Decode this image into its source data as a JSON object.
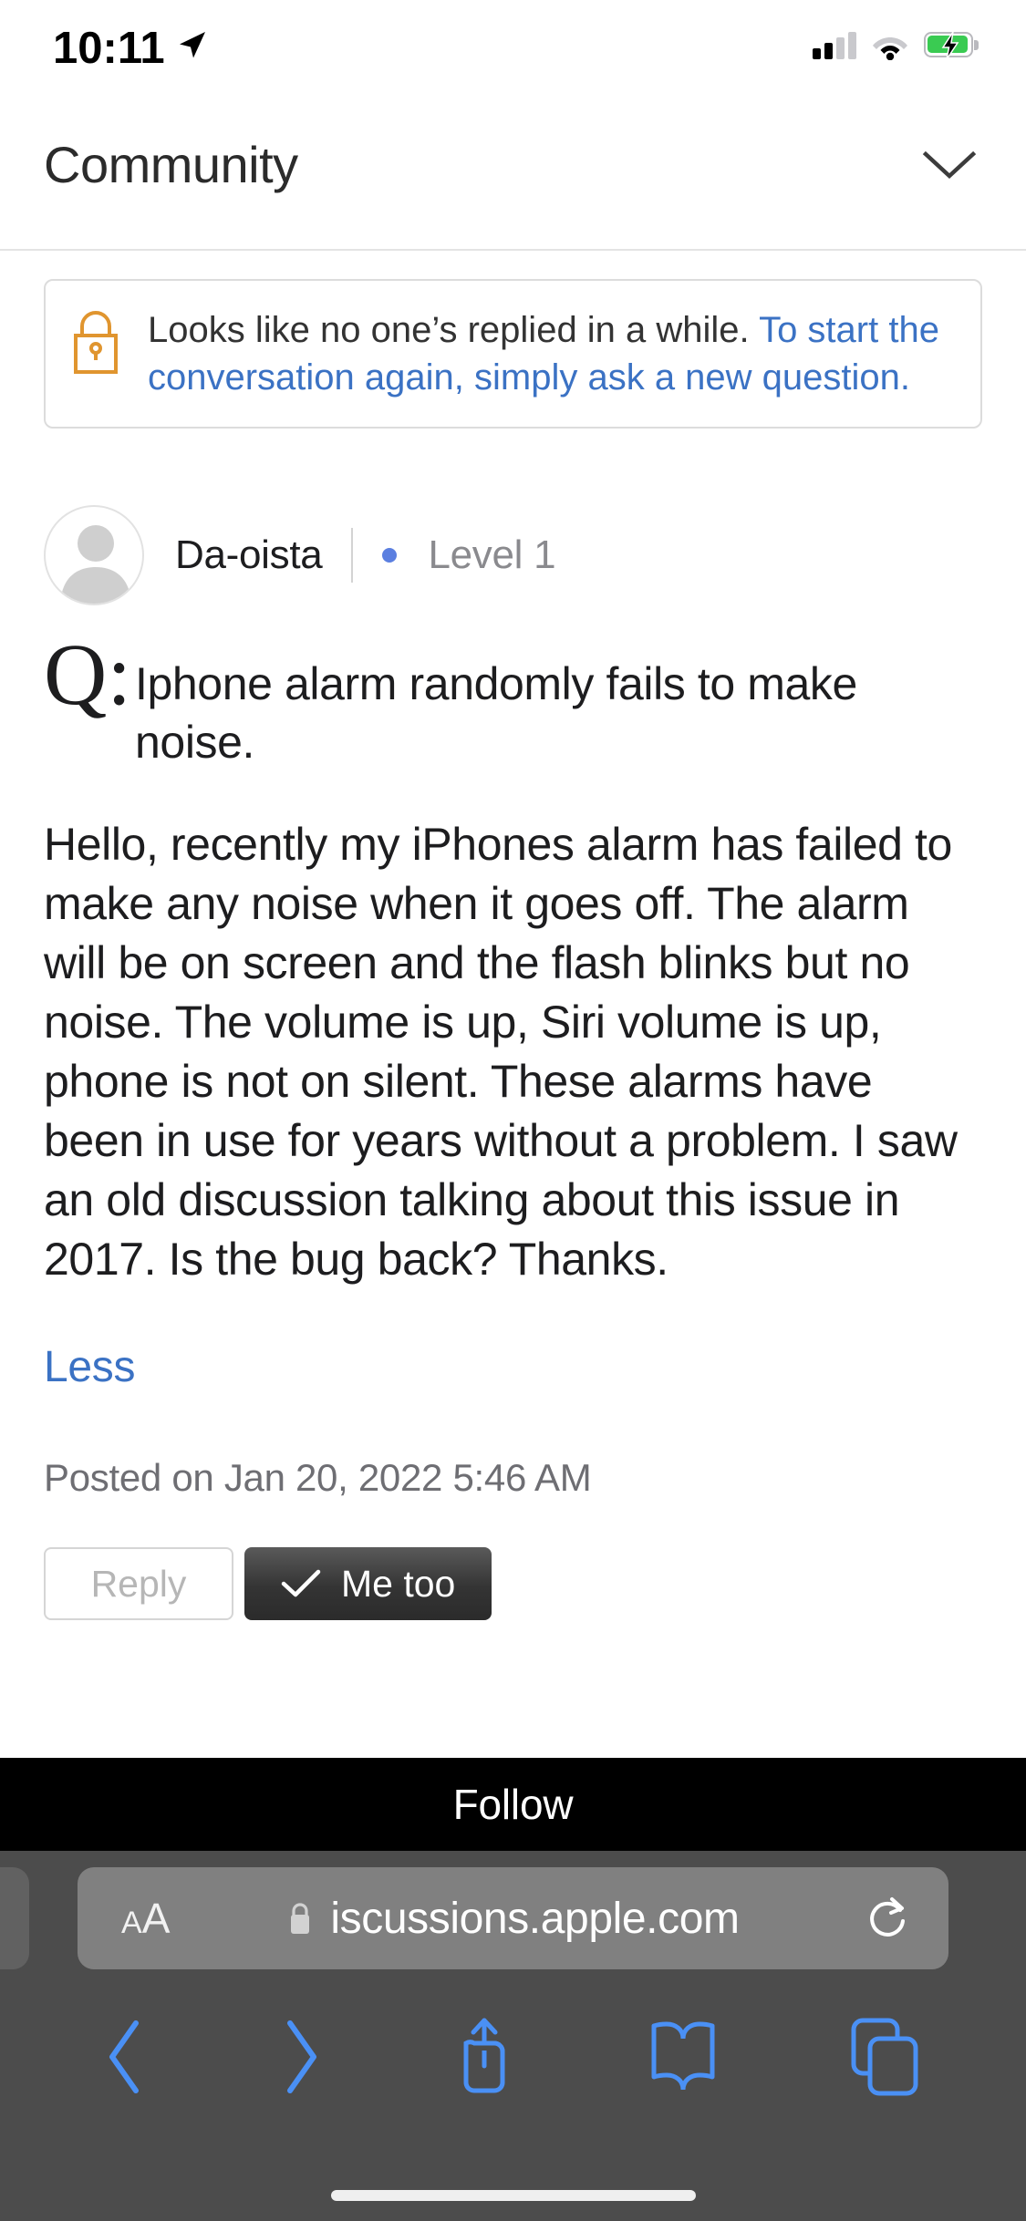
{
  "status_bar": {
    "time": "10:11",
    "location_icon": "location-arrow-icon",
    "signal_icon": "cellular-signal-icon",
    "signal_bars_filled": 2,
    "signal_bars_total": 4,
    "wifi_icon": "wifi-icon",
    "battery_icon": "battery-charging-icon",
    "battery_color": "#3ACB52"
  },
  "header": {
    "title": "Community",
    "expand_icon": "chevron-down-icon"
  },
  "notice": {
    "icon": "lock-icon",
    "icon_color": "#E0952F",
    "text_plain": "Looks like no one’s replied in a while.",
    "text_link": "To start the conversation again, simply ask a new question.",
    "link_color": "#3b72c4"
  },
  "post": {
    "avatar": "default-user-avatar",
    "author": "Da-oista",
    "level_dot_color": "#5b7fe0",
    "level": "Level 1",
    "q_prefix": "Q:",
    "title": "Iphone alarm randomly fails to make noise.",
    "body": "Hello, recently my iPhones alarm has failed to make any noise when it goes off. The alarm will be on screen and the flash blinks but no noise. The volume is up, Siri volume is up, phone is not on silent. These alarms have been in use for years without a problem. I saw an old discussion talking about this issue in 2017. Is the bug back? Thanks.",
    "toggle_label": "Less",
    "toggle_color": "#3b72c4",
    "posted": "Posted on Jan 20, 2022 5:46 AM",
    "reply_label": "Reply",
    "me_too_label": "Me too",
    "me_too_icon": "checkmark-icon"
  },
  "follow_bar": {
    "label": "Follow"
  },
  "browser": {
    "text_size_label_small": "A",
    "text_size_label_large": "A",
    "text_size_icon": "text-size-aa-icon",
    "lock_icon": "lock-icon",
    "url_prefix": "i",
    "url": "iscussions.apple.com",
    "reload_icon": "reload-icon",
    "back_icon": "chevron-left-icon",
    "forward_icon": "chevron-right-icon",
    "share_icon": "share-icon",
    "bookmarks_icon": "book-icon",
    "tabs_icon": "tabs-icon",
    "accent_color": "#4a90f5"
  }
}
